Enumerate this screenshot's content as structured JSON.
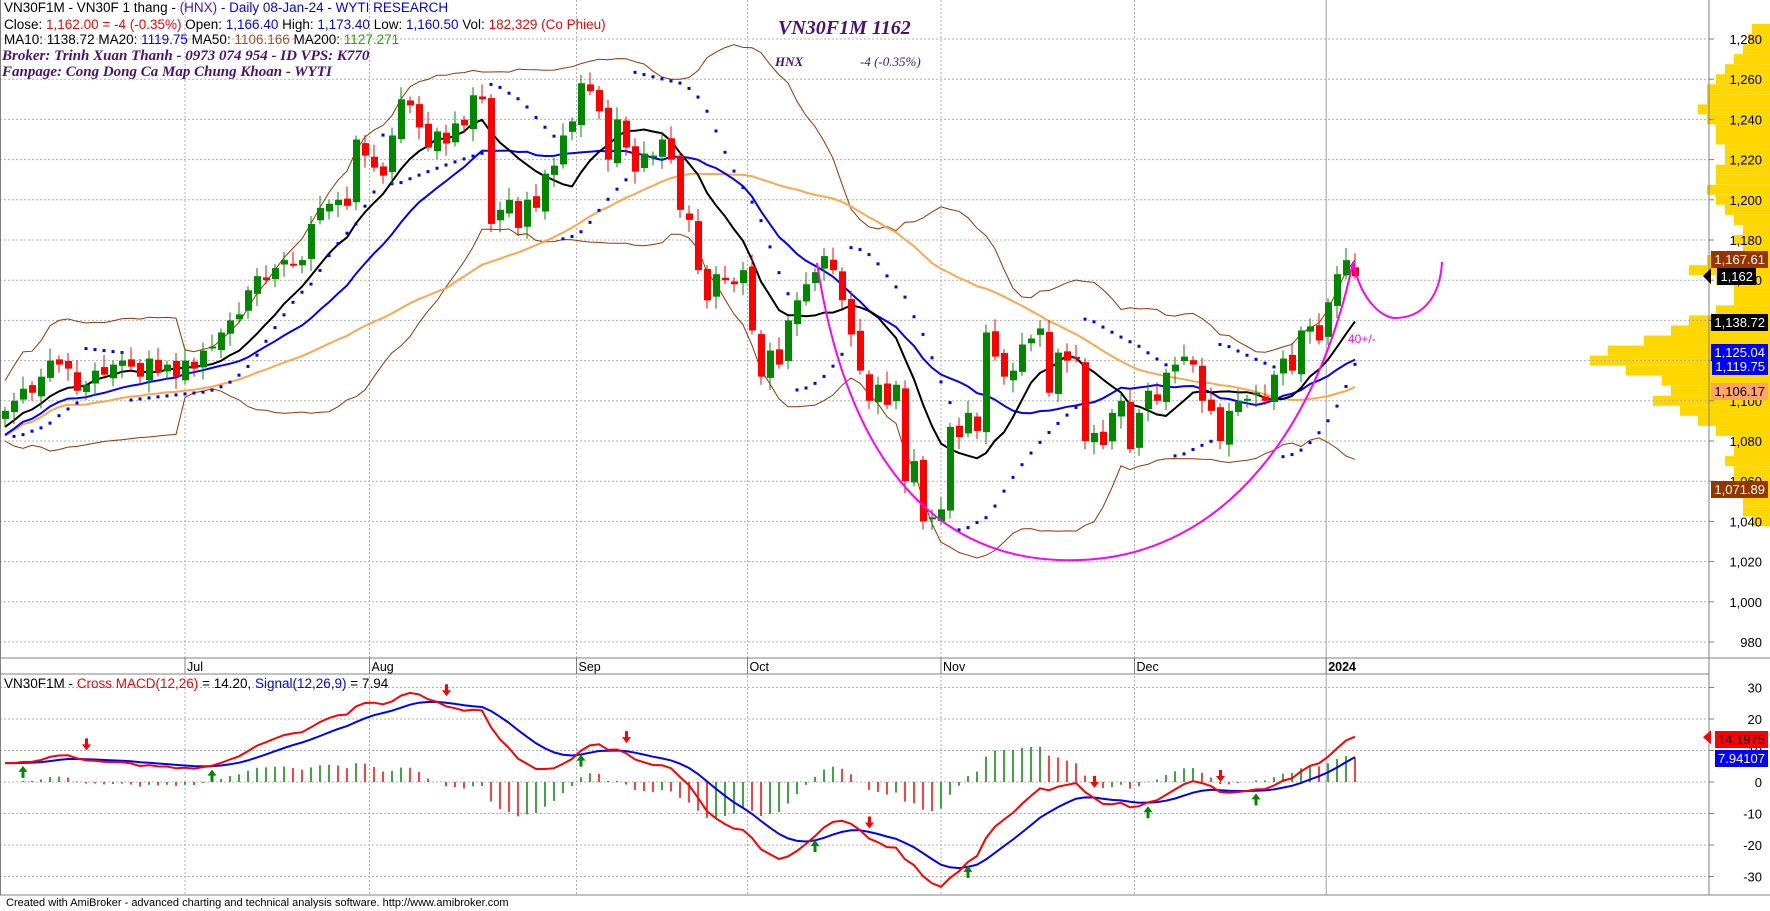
{
  "header": {
    "line1": {
      "symbol": "VN30F1M - VN30F 1 thang - ",
      "exchange": "(HNX)",
      "rest": " - Daily 08-Jan-24 - WYTI RESEARCH"
    },
    "line2": {
      "close_label": "Close: ",
      "close_value": "1,162.00 = -4 (-0.35%)",
      "open_label": " Open: ",
      "open_value": "1,166.40",
      "high_label": " High: ",
      "high_value": "1,173.40",
      "low_label": " Low: ",
      "low_value": "1,160.50",
      "vol_label": " Vol: ",
      "vol_value": "182,329 (Co Phieu)"
    },
    "line3": {
      "ma10_label": "MA10: ",
      "ma10": "1138.72",
      "ma20_label": " MA20: ",
      "ma20": "1119.75",
      "ma50_label": " MA50: ",
      "ma50": "1106.166",
      "ma200_label": " MA200: ",
      "ma200": "1127.271"
    },
    "broker": "Broker: Trinh Xuan Thanh - 0973 074 954 - ID VPS: K770",
    "fanpage": "Fanpage: Cong Dong Ca Map Chung Khoan - WYTI"
  },
  "annotations": {
    "title": "VN30F1M 1162",
    "exchange": "HNX",
    "change": "-4 (-0.35%)",
    "range_note": "40+/-"
  },
  "macd_header": {
    "symbol": "VN30F1M - ",
    "macd": "Cross MACD(12,26)",
    "macd_val": " = 14.20, ",
    "signal": "Signal(12,26,9)",
    "signal_val": " = 7.94"
  },
  "badges": {
    "bb_upper": "1,167.61",
    "close": "1,162",
    "ma10": "1,138.72",
    "sar": "1,125.04",
    "ma20": "1,119.75",
    "ma50": "1,106.17",
    "bb_lower": "1,071.89",
    "macd": "14.1975",
    "signal": "7.94107"
  },
  "footer": "Created with AmiBroker - advanced charting and technical analysis software. http://www.amibroker.com",
  "colors": {
    "up": "#008800",
    "down": "#ff0000",
    "ma10": "#000000",
    "ma20": "#0000ff",
    "ma50": "#ffa64d",
    "bb": "#993300",
    "sar": "#0000ff",
    "arc": "#ff00ff",
    "profile": "#ffd700"
  },
  "chart_data": [
    {
      "type": "candlestick",
      "title": "VN30F1M - VN30F 1 thang - (HNX) - Daily 08-Jan-24",
      "ylim": [
        970,
        1290
      ],
      "yticks": [
        980,
        1000,
        1020,
        1040,
        1060,
        1080,
        1100,
        1120,
        1140,
        1160,
        1180,
        1200,
        1220,
        1240,
        1260,
        1280
      ],
      "ytick_labels": [
        "980",
        "1,000",
        "1,020",
        "1,040",
        "1,060",
        "1,080",
        "1,100",
        "1,120",
        "1,140",
        "1,160",
        "1,180",
        "1,200",
        "1,220",
        "1,240",
        "1,260",
        "1,280"
      ],
      "months": [
        {
          "label": "Jul",
          "index": 20
        },
        {
          "label": "Aug",
          "index": 40.5
        },
        {
          "label": "Sep",
          "index": 63.5
        },
        {
          "label": "Oct",
          "index": 82.5
        },
        {
          "label": "Nov",
          "index": 104
        },
        {
          "label": "Dec",
          "index": 125.5
        },
        {
          "label": "2024",
          "index": 146.8
        }
      ],
      "close": [
        1095,
        1100,
        1106,
        1104,
        1112,
        1120,
        1118,
        1116,
        1105,
        1108,
        1115,
        1113,
        1118,
        1120,
        1117,
        1112,
        1121,
        1114,
        1118,
        1112,
        1120,
        1116,
        1125,
        1127,
        1134,
        1140,
        1143,
        1155,
        1162,
        1160,
        1166,
        1170,
        1168,
        1170,
        1188,
        1196,
        1198,
        1200,
        1197,
        1230,
        1222,
        1216,
        1212,
        1232,
        1250,
        1247,
        1236,
        1226,
        1234,
        1228,
        1238,
        1237,
        1252,
        1250,
        1188,
        1195,
        1200,
        1186,
        1200,
        1196,
        1213,
        1217,
        1232,
        1239,
        1258,
        1254,
        1244,
        1220,
        1240,
        1226,
        1214,
        1223,
        1222,
        1230,
        1220,
        1195,
        1190,
        1165,
        1150,
        1163,
        1160,
        1158,
        1165,
        1135,
        1112,
        1125,
        1118,
        1140,
        1150,
        1158,
        1164,
        1172,
        1165,
        1150,
        1133,
        1115,
        1100,
        1108,
        1098,
        1108,
        1060,
        1070,
        1040,
        1042,
        1046,
        1087,
        1082,
        1094,
        1085,
        1134,
        1122,
        1112,
        1115,
        1128,
        1131,
        1136,
        1104,
        1124,
        1120,
        1121,
        1080,
        1084,
        1078,
        1094,
        1100,
        1076,
        1094,
        1105,
        1100,
        1114,
        1118,
        1122,
        1118,
        1100,
        1095,
        1080,
        1095,
        1100,
        1101,
        1104,
        1100,
        1113,
        1121,
        1115,
        1135,
        1137,
        1130,
        1149,
        1163,
        1170,
        1162
      ],
      "last_ohlc": {
        "open": 1166.4,
        "high": 1173.4,
        "low": 1160.5,
        "close": 1162.0,
        "volume": 182329
      },
      "indicators": {
        "ma10": 1138.72,
        "ma20": 1119.75,
        "ma50": 1106.166,
        "ma200": 1127.271,
        "bb_upper": 1167.61,
        "bb_lower": 1071.89,
        "sar": 1125.04
      },
      "volume_profile": {
        "levels_from": 1285,
        "step": -5,
        "widths": [
          0.1,
          0.12,
          0.15,
          0.2,
          0.25,
          0.3,
          0.35,
          0.35,
          0.4,
          0.35,
          0.3,
          0.3,
          0.25,
          0.25,
          0.3,
          0.3,
          0.35,
          0.3,
          0.25,
          0.2,
          0.15,
          0.2,
          0.15,
          0.35,
          0.45,
          0.3,
          0.2,
          0.2,
          0.3,
          0.45,
          0.55,
          0.7,
          0.9,
          1.0,
          0.8,
          0.6,
          0.55,
          0.65,
          0.5,
          0.4,
          0.3,
          0.2,
          0.2,
          0.25,
          0.2,
          0.2,
          0.15,
          0.15,
          0.15,
          0.1
        ]
      }
    },
    {
      "type": "line",
      "title": "Cross MACD(12,26) / Signal(12,26,9)",
      "ylim": [
        -35,
        35
      ],
      "yticks": [
        -30,
        -20,
        -10,
        0,
        10,
        20,
        30
      ],
      "ytick_labels": [
        "-30",
        "-20",
        "-10",
        "0",
        "10",
        "20",
        "30"
      ],
      "series": [
        {
          "name": "MACD(12,26)",
          "last": 14.1975
        },
        {
          "name": "Signal(12,26,9)",
          "last": 7.94107
        }
      ]
    }
  ]
}
